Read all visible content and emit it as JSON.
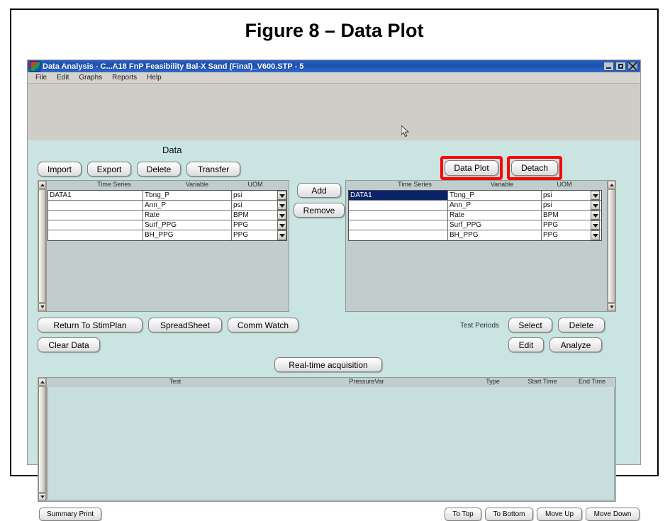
{
  "figure": {
    "caption": "Figure 8 – Data Plot"
  },
  "window": {
    "title": "Data Analysis - C...A18 FnP Feasibility Bal-X Sand (Final)_V600.STP - 5",
    "icon": "app-flag-icon",
    "controls": {
      "minimize": "minimize-icon",
      "maximize": "maximize-icon",
      "close": "close-icon"
    }
  },
  "menubar": {
    "items": [
      {
        "label": "File"
      },
      {
        "label": "Edit"
      },
      {
        "label": "Graphs"
      },
      {
        "label": "Reports"
      },
      {
        "label": "Help"
      }
    ]
  },
  "data_group": {
    "label": "Data",
    "buttons": {
      "import": "Import",
      "export": "Export",
      "delete": "Delete",
      "transfer": "Transfer"
    }
  },
  "plot_actions": {
    "data_plot": "Data Plot",
    "detach": "Detach",
    "highlight_color": "#ff0000",
    "highlighted": [
      "Data Plot",
      "Detach"
    ]
  },
  "transfer_buttons": {
    "add": "Add",
    "remove": "Remove"
  },
  "left_list": {
    "headers": [
      "Time Series",
      "Variable",
      "UOM"
    ],
    "rows": [
      {
        "time_series": "DATA1",
        "variable": "Tbng_P",
        "uom": "psi",
        "selected": false
      },
      {
        "time_series": "",
        "variable": "Ann_P",
        "uom": "psi",
        "selected": false
      },
      {
        "time_series": "",
        "variable": "Rate",
        "uom": "BPM",
        "selected": false
      },
      {
        "time_series": "",
        "variable": "Surf_PPG",
        "uom": "PPG",
        "selected": false
      },
      {
        "time_series": "",
        "variable": "BH_PPG",
        "uom": "PPG",
        "selected": false
      }
    ]
  },
  "right_list": {
    "headers": [
      "Time Series",
      "Variable",
      "UOM"
    ],
    "rows": [
      {
        "time_series": "DATA1",
        "variable": "Tbng_P",
        "uom": "psi",
        "selected": true
      },
      {
        "time_series": "",
        "variable": "Ann_P",
        "uom": "psi",
        "selected": false
      },
      {
        "time_series": "",
        "variable": "Rate",
        "uom": "BPM",
        "selected": false
      },
      {
        "time_series": "",
        "variable": "Surf_PPG",
        "uom": "PPG",
        "selected": false
      },
      {
        "time_series": "",
        "variable": "BH_PPG",
        "uom": "PPG",
        "selected": false
      }
    ]
  },
  "lower_actions": {
    "return_to_stimplan": "Return To StimPlan",
    "spreadsheet": "SpreadSheet",
    "comm_watch": "Comm Watch",
    "clear_data": "Clear Data",
    "realtime_acquisition": "Real-time acquisition"
  },
  "test_periods": {
    "label": "Test Periods",
    "select": "Select",
    "delete": "Delete",
    "edit": "Edit",
    "analyze": "Analyze"
  },
  "bottom_list": {
    "headers": [
      "Test",
      "PressureVar",
      "Type",
      "Start Time",
      "End Time"
    ],
    "rows": []
  },
  "bottom_actions": {
    "summary_print": "Summary Print",
    "to_top": "To Top",
    "to_bottom": "To Bottom",
    "move_up": "Move Up",
    "move_down": "Move Down"
  }
}
